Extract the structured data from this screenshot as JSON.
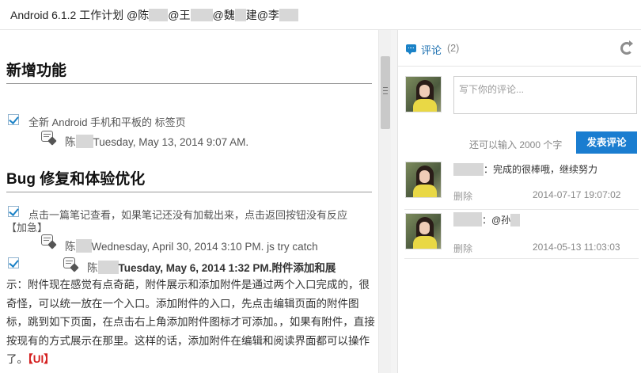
{
  "window": {
    "title_prefix": "Android 6.1.2 工作计划 @陈",
    "mention_2": "@王",
    "mention_3": "@魏",
    "mention_3_suffix": "建",
    "mention_4": "@李"
  },
  "note": {
    "sections": [
      {
        "heading": "新增功能"
      },
      {
        "heading": "Bug 修复和体验优化"
      }
    ],
    "task_1": {
      "text": "全新 Android 手机和平板的 标签页",
      "author_initial": "陈",
      "date": "Tuesday, May 13, 2014 9:07 AM."
    },
    "task_2": {
      "text": "点击一篇笔记查看，如果笔记还没有加载出来，点击返回按钮没有反应",
      "tag": "【加急】",
      "author_initial": "陈",
      "date": "Wednesday, April 30, 2014 3:10 PM.",
      "note": " js try  catch"
    },
    "task_3": {
      "author_initial": "陈",
      "date": "Tuesday, May 6, 2014 1:32 PM.",
      "title": "附件添加和展",
      "body": "示：附件现在感觉有点奇葩，附件展示和添加附件是通过两个入口完成的，很奇怪，可以统一放在一个入口。添加附件的入口，先点击编辑页面的附件图标，跳到如下页面，在点击右上角添加附件图标才可添加。，如果有附件，直接按现有的方式展示在那里。这样的话，添加附件在编辑和阅读界面都可以操作了。",
      "ui_tag": "【UI】"
    }
  },
  "comments_panel": {
    "icon": "comment-icon",
    "label": "评论",
    "count": "(2)",
    "refresh_icon": "refresh-icon",
    "input_placeholder": "写下你的评论...",
    "remaining_text": "还可以输入 2000 个字",
    "post_label": "发表评论",
    "accent_color": "#1a7dd0",
    "items": [
      {
        "text": "：完成的很棒哦，继续努力",
        "delete_label": "删除",
        "time": "2014-07-17 19:07:02"
      },
      {
        "text": "：@孙",
        "delete_label": "删除",
        "time": "2014-05-13 11:03:03"
      }
    ]
  }
}
